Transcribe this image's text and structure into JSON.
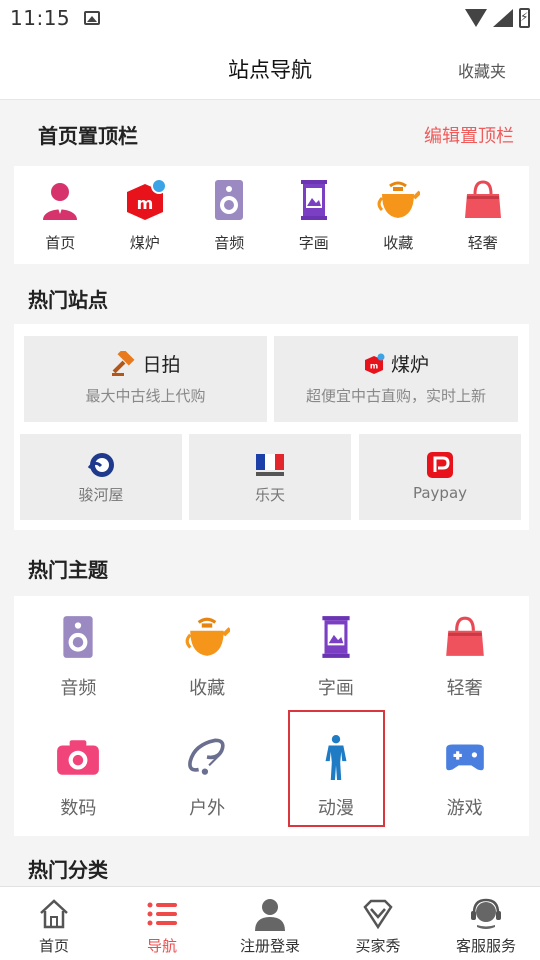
{
  "status": {
    "time": "11:15"
  },
  "header": {
    "title": "站点导航",
    "favorites": "收藏夹"
  },
  "pinned": {
    "title": "首页置顶栏",
    "edit": "编辑置顶栏",
    "items": [
      {
        "label": "首页",
        "icon": "person-icon"
      },
      {
        "label": "煤炉",
        "icon": "mercari-icon"
      },
      {
        "label": "音频",
        "icon": "speaker-icon"
      },
      {
        "label": "字画",
        "icon": "scroll-painting-icon"
      },
      {
        "label": "收藏",
        "icon": "teapot-icon"
      },
      {
        "label": "轻奢",
        "icon": "handbag-icon"
      }
    ]
  },
  "hot_sites": {
    "title": "热门站点",
    "big": [
      {
        "name": "日拍",
        "desc": "最大中古线上代购",
        "icon": "gavel-icon"
      },
      {
        "name": "煤炉",
        "desc": "超便宜中古直购，实时上新",
        "icon": "mercari-icon"
      }
    ],
    "small": [
      {
        "name": "骏河屋",
        "icon": "surugaya-logo-icon"
      },
      {
        "name": "乐天",
        "icon": "rakuten-logo-icon"
      },
      {
        "name": "Paypay",
        "icon": "paypay-logo-icon"
      }
    ]
  },
  "hot_themes": {
    "title": "热门主题",
    "items": [
      {
        "label": "音频",
        "icon": "speaker-icon"
      },
      {
        "label": "收藏",
        "icon": "teapot-icon"
      },
      {
        "label": "字画",
        "icon": "scroll-painting-icon"
      },
      {
        "label": "轻奢",
        "icon": "handbag-icon"
      },
      {
        "label": "数码",
        "icon": "camera-icon"
      },
      {
        "label": "户外",
        "icon": "fishing-hook-icon"
      },
      {
        "label": "动漫",
        "icon": "figure-icon"
      },
      {
        "label": "游戏",
        "icon": "gamepad-icon"
      }
    ]
  },
  "hot_categories": {
    "title": "热门分类"
  },
  "tabbar": {
    "items": [
      {
        "label": "首页",
        "icon": "home-icon"
      },
      {
        "label": "导航",
        "icon": "list-icon"
      },
      {
        "label": "注册登录",
        "icon": "user-icon"
      },
      {
        "label": "买家秀",
        "icon": "diamond-icon"
      },
      {
        "label": "客服服务",
        "icon": "headset-icon"
      }
    ],
    "active_index": 1
  },
  "colors": {
    "accent": "#ef4a4a",
    "edit_link": "#ef5b5b",
    "highlight_border": "#d9363e"
  }
}
